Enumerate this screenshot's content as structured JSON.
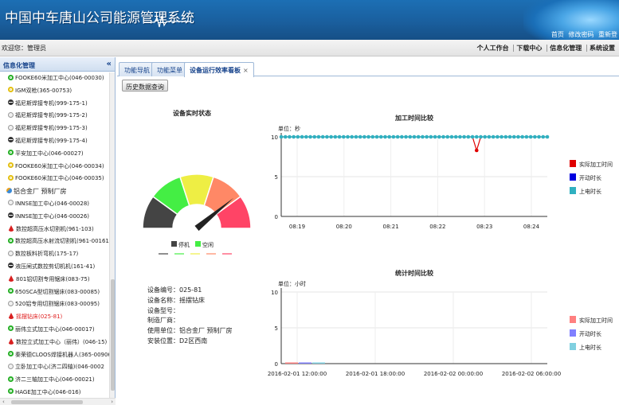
{
  "header": {
    "title": "中国中车唐山公司能源管理系统",
    "links": [
      "首页",
      "修改密码",
      "重新登"
    ]
  },
  "welcome": {
    "text": "欢迎您：管理员",
    "nav": [
      "个人工作台",
      "下载中心",
      "信息化管理",
      "系统设置"
    ]
  },
  "sidebar": {
    "title": "信息化管理",
    "collapse": "«",
    "items": [
      {
        "label": "FOOKE60米加工中心(046-00030)",
        "icon": "green"
      },
      {
        "label": "IGM双枪(365-00753)",
        "icon": "yellow"
      },
      {
        "label": "福尼斯焊接专机(999-175-1)",
        "icon": "black"
      },
      {
        "label": "福尼斯焊接专机(999-175-2)",
        "icon": "doc"
      },
      {
        "label": "福尼斯焊接专机(999-175-3)",
        "icon": "doc"
      },
      {
        "label": "福尼斯焊接专机(999-175-4)",
        "icon": "black"
      },
      {
        "label": "平安加工中心(046-00027)",
        "icon": "green"
      },
      {
        "label": "FOOKE60米加工中心(046-00034)",
        "icon": "yellow"
      },
      {
        "label": "FOOKE60米加工中心(046-00035)",
        "icon": "yellow"
      },
      {
        "label": "铝合金厂  预制厂房",
        "icon": "org",
        "group": true
      },
      {
        "label": "INNSE加工中心(046-00028)",
        "icon": "doc"
      },
      {
        "label": "INNSE加工中心(046-00026)",
        "icon": "black"
      },
      {
        "label": "数控超高压水切割机(961-103)",
        "icon": "red"
      },
      {
        "label": "数控超高压水射流切割机(961-00161)",
        "icon": "green"
      },
      {
        "label": "数控板料折弯机(175-17)",
        "icon": "doc"
      },
      {
        "label": "液压闸式数控剪切机机(161-41)",
        "icon": "black"
      },
      {
        "label": "801铝切割专用锯床(083-75)",
        "icon": "red"
      },
      {
        "label": "650SCA型切割锯床(083-00085)",
        "icon": "green"
      },
      {
        "label": "520铝专用切割锯床(083-00095)",
        "icon": "doc"
      },
      {
        "label": "摇摆钻床(025-81)",
        "icon": "red",
        "selected": true
      },
      {
        "label": "丽伟立式加工中心(046-00017)",
        "icon": "green"
      },
      {
        "label": "数控立式加工中心（丽伟）(046-15)",
        "icon": "red"
      },
      {
        "label": "秦荣德CLOOS焊接机器人(365-00906)",
        "icon": "green"
      },
      {
        "label": "立卧加工中心(济二四轴)(046-0002",
        "icon": "doc"
      },
      {
        "label": "济二三轴加工中心(046-00021)",
        "icon": "green"
      },
      {
        "label": "HAGE加工中心(046-016)",
        "icon": "green"
      }
    ],
    "scroll_left": "‹",
    "scroll_right": "›"
  },
  "tabs": [
    {
      "label": "功能导航",
      "active": false
    },
    {
      "label": "功能菜单",
      "active": false
    },
    {
      "label": "设备运行效率看板",
      "active": true,
      "close": "×"
    }
  ],
  "toolbar": {
    "history_button": "历史数据查询"
  },
  "gauge": {
    "title": "设备实时状态",
    "segments": [
      {
        "color": "#444444"
      },
      {
        "color": "#44ee44"
      },
      {
        "color": "#eeee44"
      },
      {
        "color": "#ff8866"
      },
      {
        "color": "#ff4466"
      }
    ],
    "value_fraction": 0.78,
    "legend": [
      {
        "label": "停机",
        "color": "#444444"
      },
      {
        "label": "空闲",
        "color": "#44ee44"
      }
    ]
  },
  "device_info": {
    "rows": [
      "设备编号：025-81",
      "设备名称：摇摆钻床",
      "设备型号：",
      "制造厂商：",
      "使用单位：铝合金厂 预制厂房",
      "安装位置：D2区西南"
    ]
  },
  "chart_data": [
    {
      "type": "line",
      "title": "加工时间比较",
      "unit_label": "单位：秒",
      "ylim": [
        0,
        10
      ],
      "yticks": [
        0,
        5,
        10
      ],
      "xticks": [
        "08:19",
        "08:20",
        "08:21",
        "08:22",
        "08:23",
        "08:24"
      ],
      "grid": true,
      "legend_position": "right",
      "series": [
        {
          "name": "实际加工时间",
          "color": "#e00000",
          "values": [
            10,
            10,
            10,
            10,
            10,
            10,
            10,
            10,
            10,
            10,
            10,
            10,
            10,
            10,
            10,
            10,
            10,
            10,
            10,
            10,
            10,
            10,
            10,
            10,
            10,
            10,
            10,
            10,
            10,
            10,
            10,
            10,
            10,
            10,
            10,
            10,
            10,
            10,
            10,
            10,
            10,
            10,
            10,
            10,
            10,
            10,
            10,
            8.3,
            10,
            10,
            10,
            10,
            10,
            10,
            10,
            10,
            10,
            10,
            10,
            10,
            10,
            10,
            10,
            10,
            10
          ]
        },
        {
          "name": "开动时长",
          "color": "#0000e0",
          "values": []
        },
        {
          "name": "上电时长",
          "color": "#30b0c0",
          "values": [
            10,
            10,
            10,
            10,
            10,
            10,
            10,
            10,
            10,
            10,
            10,
            10,
            10,
            10,
            10,
            10,
            10,
            10,
            10,
            10,
            10,
            10,
            10,
            10,
            10,
            10,
            10,
            10,
            10,
            10,
            10,
            10,
            10,
            10,
            10,
            10,
            10,
            10,
            10,
            10,
            10,
            10,
            10,
            10,
            10,
            10,
            10,
            10,
            10,
            10,
            10,
            10,
            10,
            10,
            10,
            10,
            10,
            10,
            10,
            10,
            10,
            10,
            10,
            10,
            10
          ]
        }
      ]
    },
    {
      "type": "bar",
      "title": "统计时间比较",
      "unit_label": "单位：小时",
      "ylim": [
        0,
        10
      ],
      "yticks": [
        0,
        5,
        10
      ],
      "xticks": [
        "2016-02-01 12:00:00",
        "2016-02-01 18:00:00",
        "2016-02-02 00:00:00",
        "2016-02-02 06:00:00"
      ],
      "grid": true,
      "legend_position": "right",
      "series": [
        {
          "name": "实际加工时间",
          "color": "#ff8080"
        },
        {
          "name": "开动时长",
          "color": "#8080ff"
        },
        {
          "name": "上电时长",
          "color": "#80d0e0"
        }
      ]
    }
  ]
}
